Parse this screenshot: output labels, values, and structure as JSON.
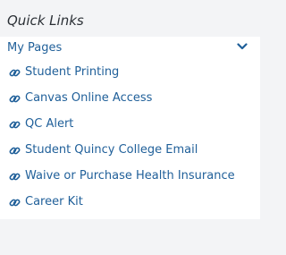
{
  "widget": {
    "title": "Quick Links",
    "section": {
      "label": "My Pages",
      "toggle_icon": "chevron-down-icon",
      "expanded": true
    },
    "link_icon": "link-icon",
    "links": [
      {
        "label": "Student Printing"
      },
      {
        "label": "Canvas Online Access"
      },
      {
        "label": "QC Alert"
      },
      {
        "label": "Student Quincy College Email"
      },
      {
        "label": "Waive or Purchase Health Insurance"
      },
      {
        "label": "Career Kit"
      }
    ]
  },
  "colors": {
    "background": "#f3f4f6",
    "panel": "#ffffff",
    "link": "#1f5f99",
    "title": "#2a2f35"
  }
}
